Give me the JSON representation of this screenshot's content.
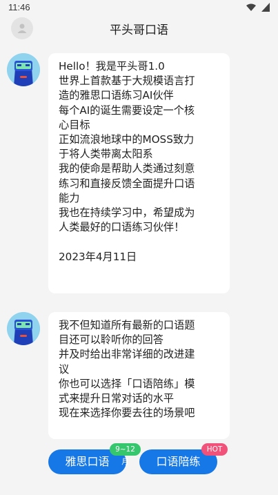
{
  "status_bar": {
    "time": "11:46",
    "icons": [
      "wifi-icon",
      "signal-icon"
    ]
  },
  "header": {
    "title": "平头哥口语",
    "avatar_icon": "user-icon"
  },
  "messages": [
    {
      "avatar_icon": "robot-icon",
      "lines": [
        "Hello！我是平头哥1.0",
        "世界上首款基于大规模语言打",
        "造的雅思口语练习AI伙伴",
        "每个AI的诞生需要设定一个核",
        "心目标",
        "正如流浪地球中的MOSS致力",
        "于将人类带离太阳系",
        "我的使命是帮助人类通过刻意",
        "练习和直接反馈全面提升口语",
        "能力",
        "我也在持续学习中，希望成为",
        "人类最好的口语练习伙伴！",
        " ",
        "2023年4月11日"
      ]
    },
    {
      "avatar_icon": "robot-icon",
      "lines": [
        "我不但知道所有最新的口语题",
        "目还可以聆听你的回答",
        "并及时给出非常详细的改进建",
        "议",
        "你也可以选择「口语陪练」模",
        "式来提升日常对话的水平",
        "现在来选择你要去往的场景吧"
      ]
    }
  ],
  "actions": [
    {
      "label": "雅思口语",
      "badge": "9~12月"
    },
    {
      "label": "口语陪练",
      "badge": "HOT"
    }
  ],
  "colors": {
    "accent": "#1677e6",
    "badge_green": "#36c66e",
    "badge_hot": "#f0527a",
    "background": "#f4f4f4"
  }
}
